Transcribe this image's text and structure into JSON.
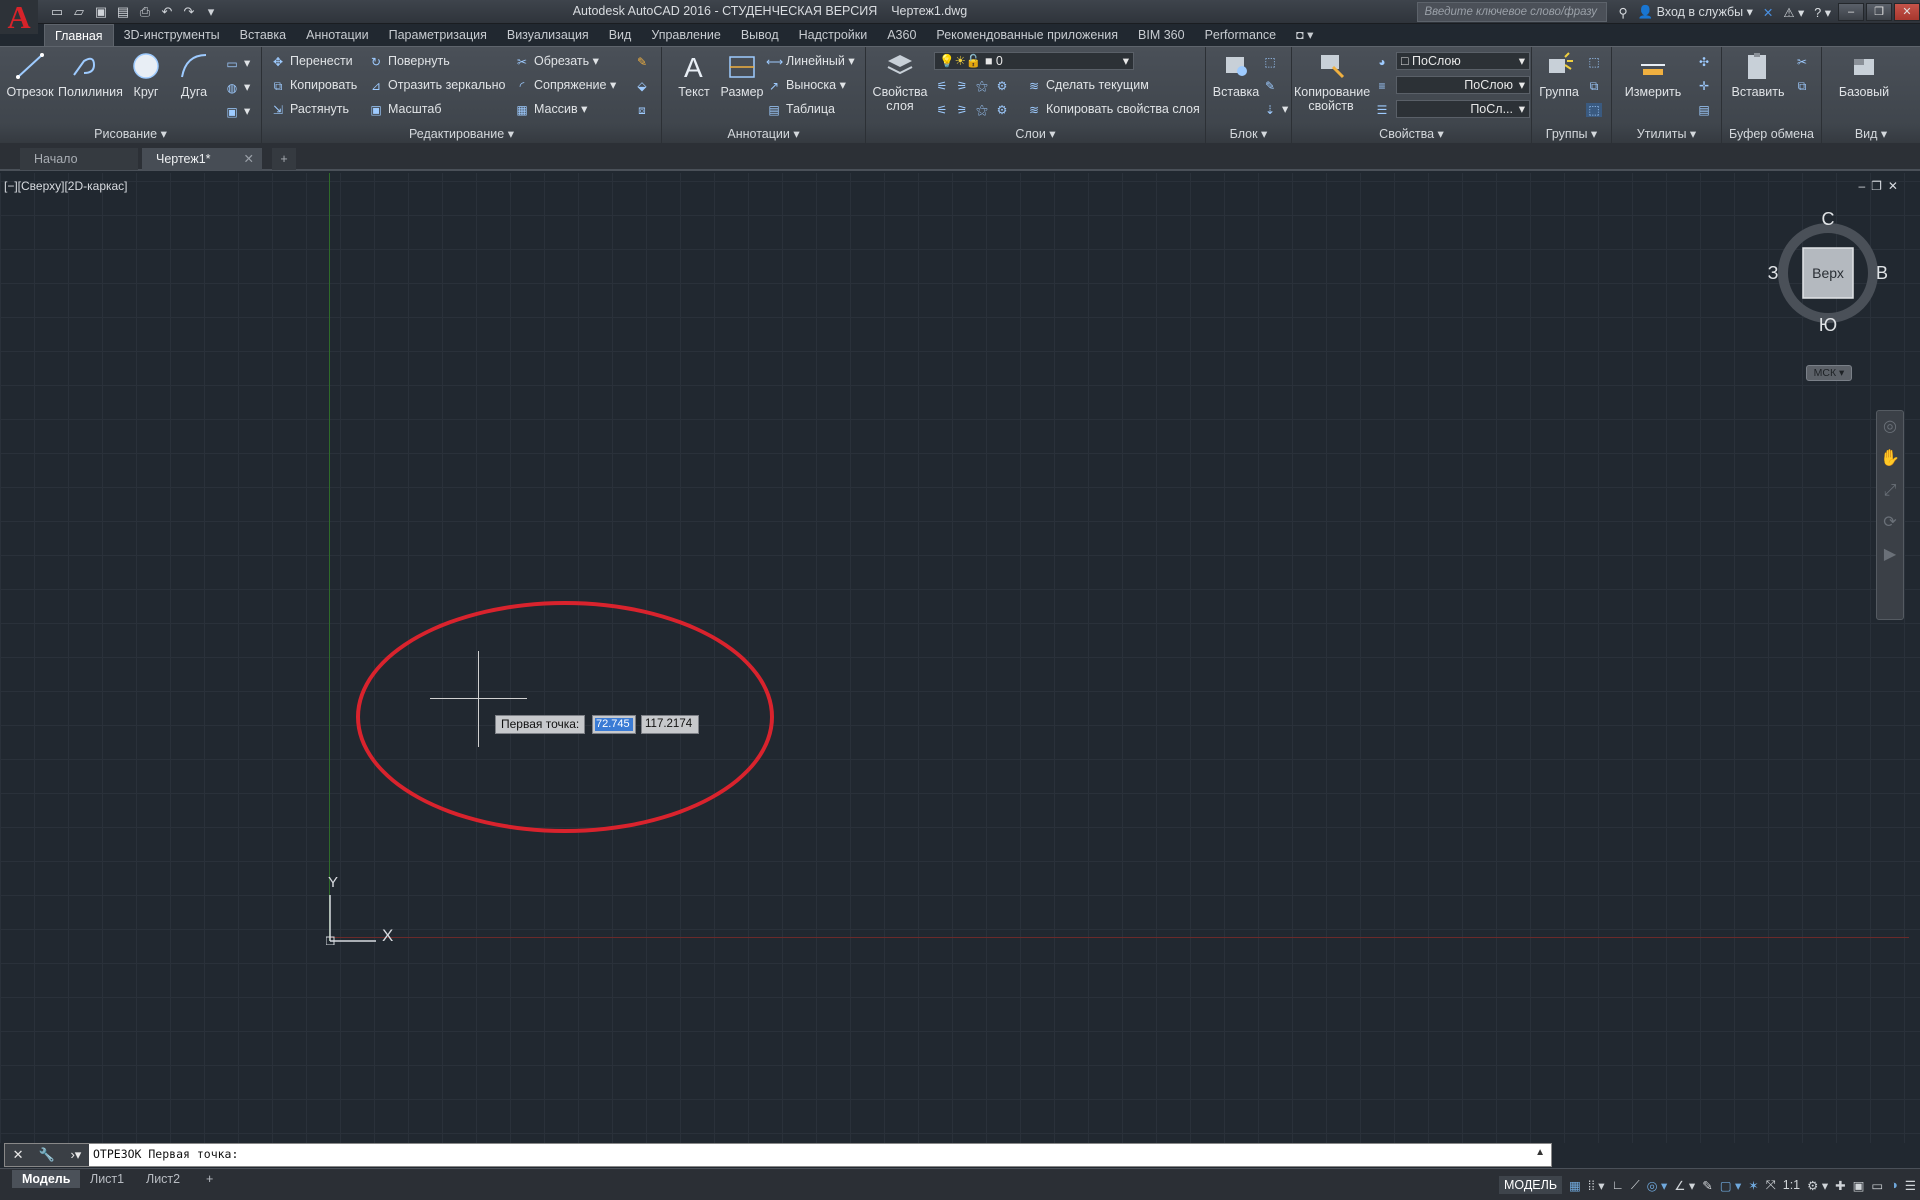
{
  "window": {
    "title": "Autodesk AutoCAD 2016 - СТУДЕНЧЕСКАЯ ВЕРСИЯ    Чертеж1.dwg",
    "search_placeholder": "Введите ключевое слово/фразу",
    "signin": "Вход в службы",
    "help": "?"
  },
  "ribbon_tabs": [
    "Главная",
    "3D-инструменты",
    "Вставка",
    "Аннотации",
    "Параметризация",
    "Визуализация",
    "Вид",
    "Управление",
    "Вывод",
    "Надстройки",
    "A360",
    "Рекомендованные приложения",
    "BIM 360",
    "Performance"
  ],
  "ribbon": {
    "draw": {
      "title": "Рисование",
      "line": "Отрезок",
      "polyline": "Полилиния",
      "circle": "Круг",
      "arc": "Дуга"
    },
    "modify": {
      "title": "Редактирование",
      "move": "Перенести",
      "rotate": "Повернуть",
      "trim": "Обрезать",
      "copy": "Копировать",
      "mirror": "Отразить зеркально",
      "fillet": "Сопряжение",
      "stretch": "Растянуть",
      "scale": "Масштаб",
      "array": "Массив"
    },
    "annotation": {
      "title": "Аннотации",
      "text": "Текст",
      "dimension": "Размер",
      "linear": "Линейный",
      "leader": "Выноска",
      "table": "Таблица"
    },
    "layers": {
      "title": "Слои",
      "layer_props": "Свойства слоя",
      "current_layer": "0",
      "make_current": "Сделать текущим",
      "match_layer": "Копировать свойства слоя"
    },
    "block": {
      "title": "Блок",
      "insert": "Вставка"
    },
    "properties": {
      "title": "Свойства",
      "match_props": "Копирование свойств",
      "color": "ПоСлою",
      "linetype": "ПоСлою",
      "lineweight": "ПоСл..."
    },
    "groups": {
      "title": "Группы",
      "group": "Группа"
    },
    "utilities": {
      "title": "Утилиты",
      "measure": "Измерить"
    },
    "clipboard": {
      "title": "Буфер обмена",
      "paste": "Вставить"
    },
    "view": {
      "title": "Вид",
      "base": "Базовый"
    }
  },
  "doc_tabs": [
    "Начало",
    "Чертеж1*"
  ],
  "viewport": {
    "label": "[−][Сверху][2D-каркас]",
    "viewcube": {
      "face": "Верх",
      "north": "С",
      "south": "Ю",
      "east": "В",
      "west": "З"
    },
    "ucs_menu": "МСК",
    "axis_x": "X",
    "axis_y": "Y"
  },
  "dynamic_input": {
    "prompt": "Первая точка:",
    "x_value": "72.745",
    "y_value": "117.2174"
  },
  "command_line": {
    "text": "ОТРЕЗОК Первая точка:"
  },
  "layout_tabs": [
    "Модель",
    "Лист1",
    "Лист2"
  ],
  "status": {
    "space": "МОДЕЛЬ",
    "scale": "1:1"
  },
  "colors": {
    "accent": "#d9232d",
    "canvas": "#212830",
    "highlight": "#3a7bd5"
  }
}
